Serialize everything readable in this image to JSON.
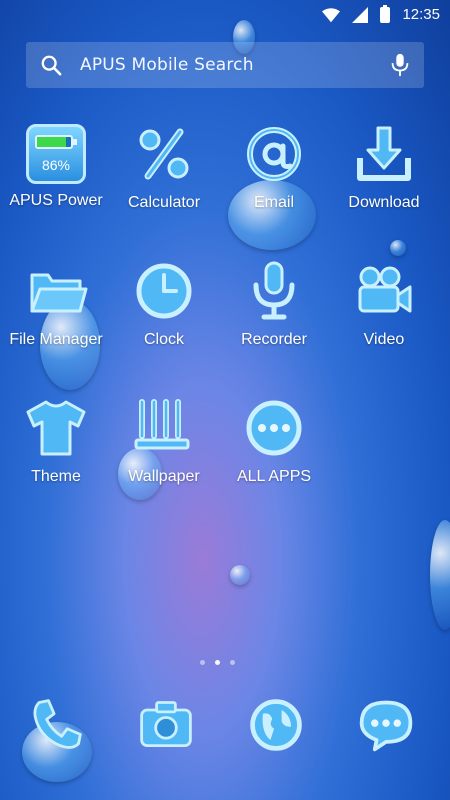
{
  "status_bar": {
    "time": "12:35"
  },
  "search": {
    "placeholder": "APUS Mobile Search"
  },
  "apps": [
    {
      "label": "APUS Power",
      "battery_percent": "86%",
      "battery_level": 0.86
    },
    {
      "label": "Calculator"
    },
    {
      "label": "Email"
    },
    {
      "label": "Download"
    },
    {
      "label": "File Manager"
    },
    {
      "label": "Clock"
    },
    {
      "label": "Recorder"
    },
    {
      "label": "Video"
    },
    {
      "label": "Theme"
    },
    {
      "label": "Wallpaper"
    },
    {
      "label": "ALL APPS"
    }
  ],
  "dock": [
    {
      "icon": "phone-icon"
    },
    {
      "icon": "camera-icon"
    },
    {
      "icon": "browser-icon"
    },
    {
      "icon": "messages-icon"
    }
  ],
  "pager": {
    "pages": 3,
    "active": 2
  },
  "colors": {
    "icon_fill": "#4fb8f5",
    "icon_stroke": "#bdeaff",
    "wallpaper": "#1a58c4"
  }
}
